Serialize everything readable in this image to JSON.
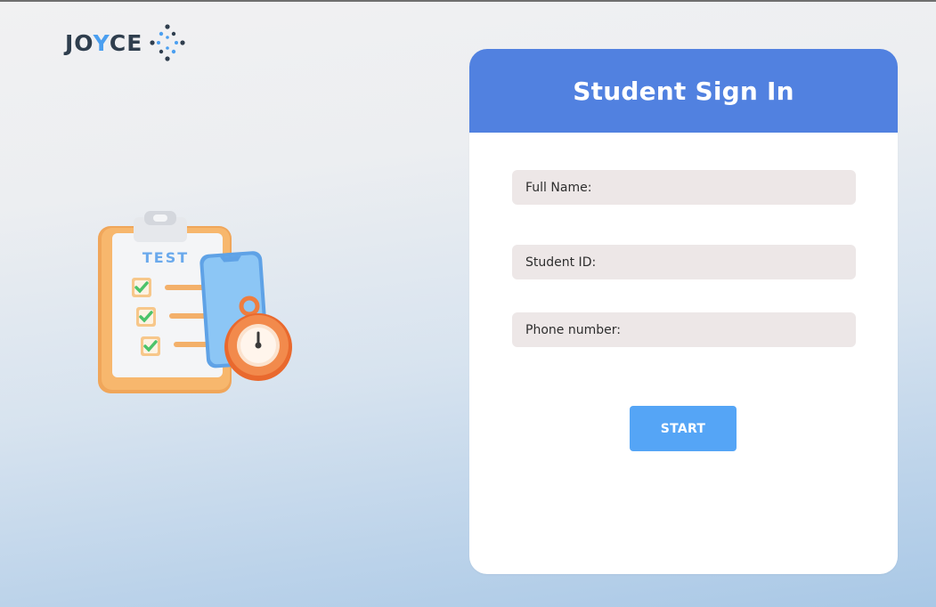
{
  "logo": {
    "text_start": "JO",
    "text_accent": "Y",
    "text_end": "CE"
  },
  "illustration": {
    "clipboard_label": "TEST",
    "icon": "clipboard-test-stopwatch-icon"
  },
  "signin": {
    "title": "Student Sign In",
    "fields": [
      {
        "label": "Full Name:",
        "value": ""
      },
      {
        "label": "Student ID:",
        "value": ""
      },
      {
        "label": "Phone number:",
        "value": ""
      }
    ],
    "start_label": "START"
  },
  "colors": {
    "header": "#5181e0",
    "button": "#55a5f6",
    "field_bg": "#ede7e7",
    "logo_accent": "#4b9ff0"
  }
}
